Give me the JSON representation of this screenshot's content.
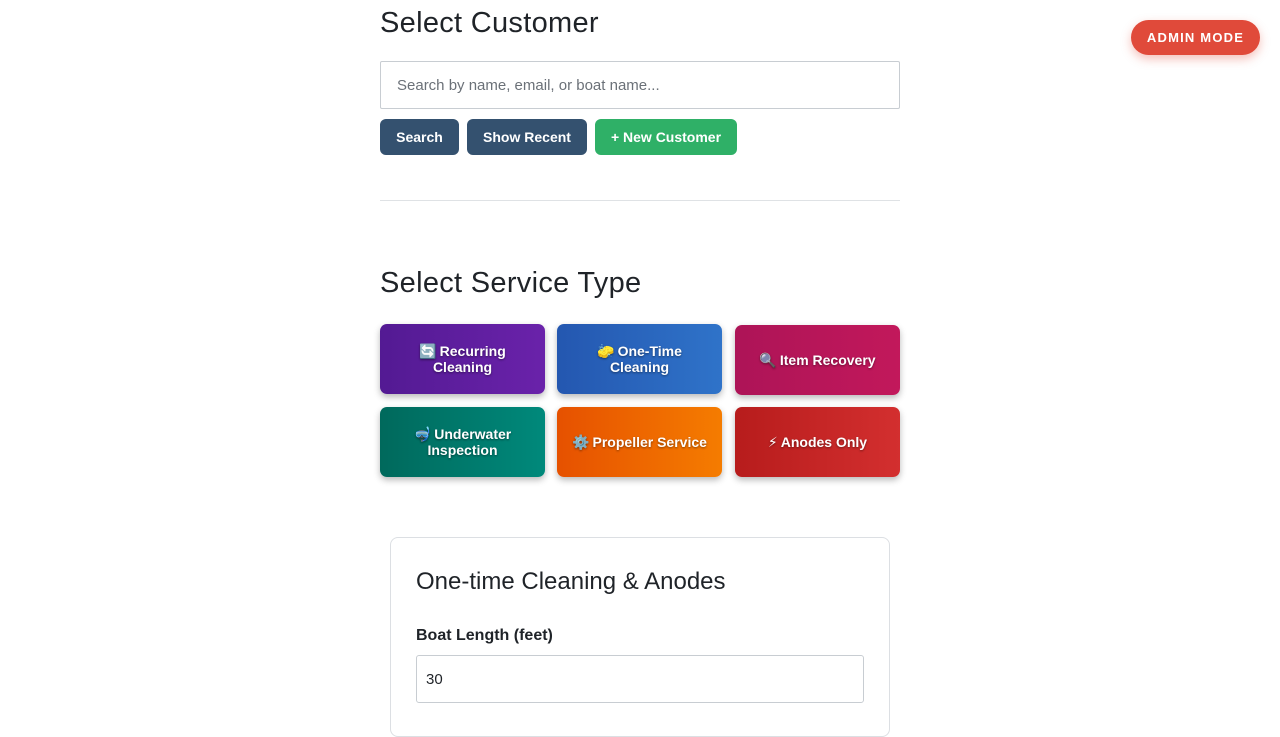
{
  "admin_mode_label": "ADMIN MODE",
  "customer": {
    "title": "Select Customer",
    "search_placeholder": "Search by name, email, or boat name...",
    "search_value": "",
    "buttons": {
      "search": "Search",
      "show_recent": "Show Recent",
      "new_customer": "+ New Customer"
    }
  },
  "service": {
    "title": "Select Service Type",
    "options": [
      {
        "icon": "🔄",
        "icon_name": "recurring-arrows-icon",
        "label": "Recurring Cleaning",
        "color": "#5b1c9c"
      },
      {
        "icon": "🧽",
        "icon_name": "sponge-icon",
        "label": "One-Time Cleaning",
        "color": "#2a65bd"
      },
      {
        "icon": "🔍",
        "icon_name": "magnifier-icon",
        "label": "Item Recovery",
        "color": "#b8165a"
      },
      {
        "icon": "🤿",
        "icon_name": "diving-mask-icon",
        "label": "Underwater Inspection",
        "color": "#00796b"
      },
      {
        "icon": "⚙️",
        "icon_name": "gear-icon",
        "label": "Propeller Service",
        "color": "#ee6700"
      },
      {
        "icon": "⚡",
        "icon_name": "lightning-icon",
        "label": "Anodes Only",
        "color": "#c62828"
      }
    ]
  },
  "pricing_card": {
    "title": "One-time Cleaning & Anodes",
    "boat_length_label": "Boat Length (feet)",
    "boat_length_value": "30"
  },
  "colors": {
    "admin": "#e04a3a",
    "dark_button": "#34516f",
    "green_button": "#2fb067"
  }
}
